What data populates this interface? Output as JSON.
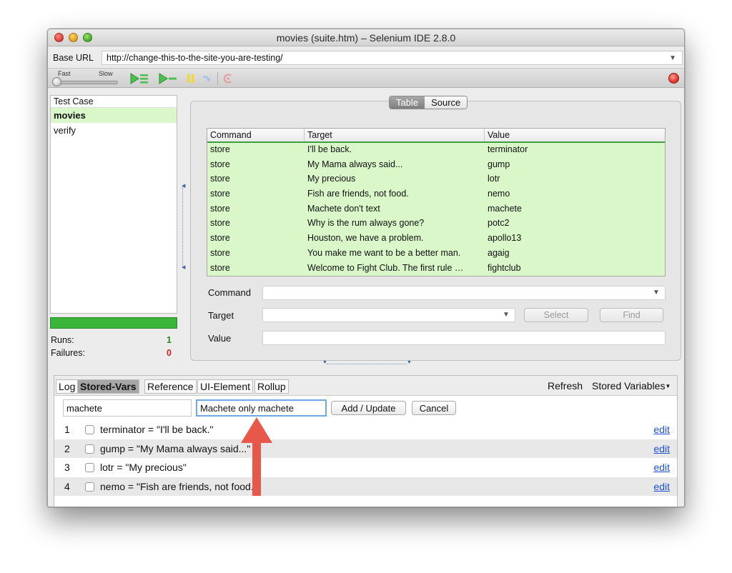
{
  "window": {
    "title": "movies (suite.htm) – Selenium IDE 2.8.0"
  },
  "base_url": {
    "label": "Base URL",
    "value": "http://change-this-to-the-site-you-are-testing/"
  },
  "toolbar": {
    "speed_fast": "Fast",
    "speed_slow": "Slow",
    "icons": [
      "play-suite-icon",
      "play-test-icon",
      "pause-icon",
      "step-icon",
      "rollup-icon",
      "record-icon"
    ]
  },
  "test_cases": {
    "header": "Test Case",
    "items": [
      {
        "label": "movies",
        "selected": true
      },
      {
        "label": "verify",
        "selected": false
      }
    ]
  },
  "stats": {
    "runs_label": "Runs:",
    "runs_value": "1",
    "failures_label": "Failures:",
    "failures_value": "0",
    "progress": 1.0
  },
  "editor": {
    "tabs": {
      "table": "Table",
      "source": "Source",
      "active": "table"
    },
    "columns": {
      "command": "Command",
      "target": "Target",
      "value": "Value"
    },
    "rows": [
      {
        "command": "store",
        "target": "I'll be back.",
        "value": "terminator"
      },
      {
        "command": "store",
        "target": "My Mama always said...",
        "value": "gump"
      },
      {
        "command": "store",
        "target": "My precious",
        "value": "lotr"
      },
      {
        "command": "store",
        "target": "Fish are friends, not food.",
        "value": "nemo"
      },
      {
        "command": "store",
        "target": "Machete don't text",
        "value": "machete"
      },
      {
        "command": "store",
        "target": "Why is the rum always gone?",
        "value": "potc2"
      },
      {
        "command": "store",
        "target": "Houston, we have a problem.",
        "value": "apollo13"
      },
      {
        "command": "store",
        "target": "You make me want to be a better man.",
        "value": "agaig"
      },
      {
        "command": "store",
        "target": "Welcome to Fight Club. The first rule …",
        "value": "fightclub"
      }
    ],
    "command_label": "Command",
    "target_label": "Target",
    "value_label": "Value",
    "select_button": "Select",
    "find_button": "Find"
  },
  "bottom": {
    "tabs": [
      "Log",
      "Stored-Vars",
      "Reference",
      "UI-Element",
      "Rollup"
    ],
    "active_tab": "Stored-Vars",
    "refresh": "Refresh",
    "stored_variables": "Stored Variables",
    "var_name_value": "machete",
    "var_value_value": "Machete only machete",
    "add_update_button": "Add / Update",
    "cancel_button": "Cancel",
    "variables": [
      {
        "index": "1",
        "text": "terminator = \"I'll be back.\"",
        "edit": "edit"
      },
      {
        "index": "2",
        "text": "gump = \"My Mama always said...\"",
        "edit": "edit"
      },
      {
        "index": "3",
        "text": "lotr = \"My precious\"",
        "edit": "edit"
      },
      {
        "index": "4",
        "text": "nemo = \"Fish are friends, not food.\"",
        "edit": "edit"
      }
    ]
  },
  "colors": {
    "row_green": "#d9f7c9",
    "progress_green": "#3ab53a",
    "annotation_arrow": "#e8584a",
    "link_blue": "#1a4fd8"
  }
}
